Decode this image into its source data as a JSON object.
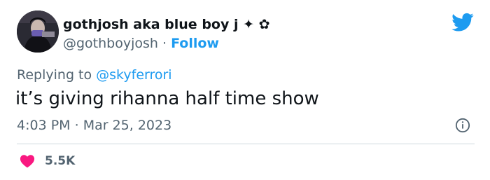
{
  "author": {
    "display_name": "gothjosh aka blue boy j ✦ ✿",
    "handle": "@gothboyjosh",
    "separator": " · ",
    "follow_label": "Follow"
  },
  "reply": {
    "prefix": "Replying to ",
    "user": "@skyferrori"
  },
  "tweet": {
    "text": "it’s giving rihanna half time show",
    "time": "4:03 PM",
    "separator": " · ",
    "date": "Mar 25, 2023"
  },
  "engagement": {
    "like_count": "5.5K"
  },
  "icons": {
    "logo": "twitter-bird-icon",
    "info": "info-icon",
    "like": "heart-icon"
  },
  "colors": {
    "brand": "#1d9bf0",
    "like": "#f91880",
    "text": "#0f1419",
    "muted": "#536471"
  }
}
